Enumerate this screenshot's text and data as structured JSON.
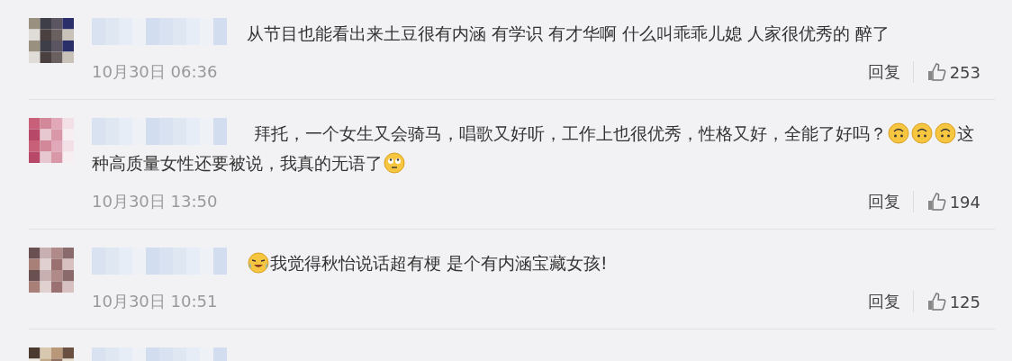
{
  "comments": [
    {
      "parts": [
        {
          "kind": "text",
          "text": "从节目也能看出来土豆很有内涵 有学识 有才华啊 什么叫乖乖儿媳 人家很优秀的 醉了"
        }
      ],
      "time": "10月30日 06:36",
      "reply": "回复",
      "likes": "253"
    },
    {
      "parts": [
        {
          "kind": "text",
          "text": "拜托，一个女生又会骑马，唱歌又好听，工作上也很优秀，性格又好，全能了好吗？"
        },
        {
          "kind": "upside-down-emoji"
        },
        {
          "kind": "upside-down-emoji"
        },
        {
          "kind": "upside-down-emoji"
        },
        {
          "kind": "text",
          "text": "这"
        },
        {
          "kind": "text",
          "text": "种高质量女性还要被说，我真的无语了"
        },
        {
          "kind": "rolling-eyes-emoji"
        }
      ],
      "time": "10月30日 13:50",
      "reply": "回复",
      "likes": "194"
    },
    {
      "parts": [
        {
          "kind": "laughing-emoji"
        },
        {
          "kind": "text",
          "text": "我觉得秋怡说话超有梗 是个有内涵宝藏女孩!"
        }
      ],
      "time": "10月30日 10:51",
      "reply": "回复",
      "likes": "125"
    }
  ]
}
